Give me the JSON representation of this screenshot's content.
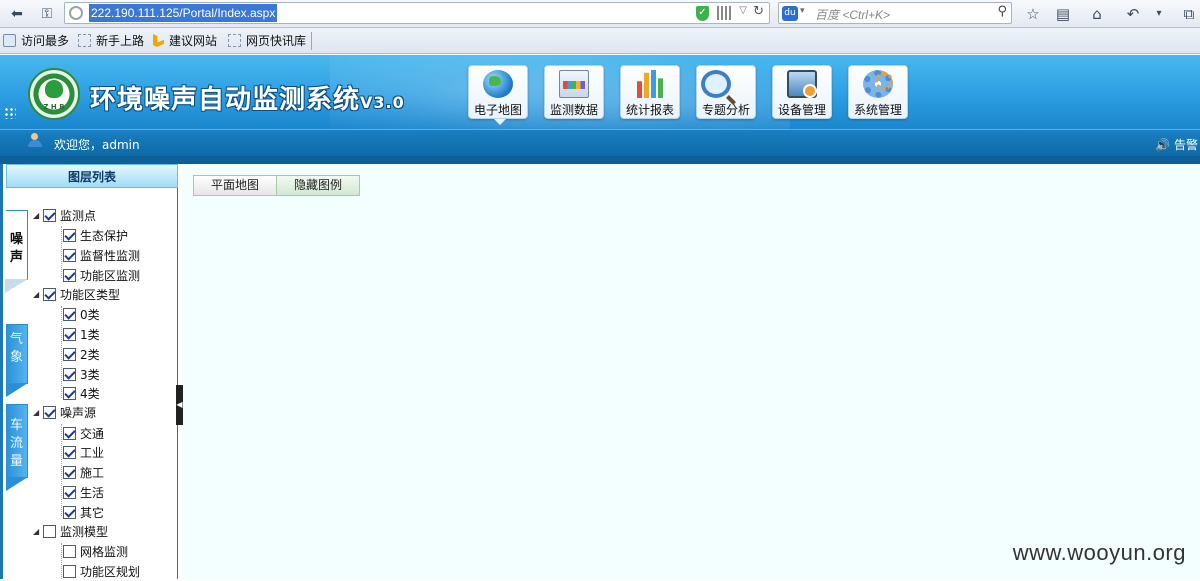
{
  "browser": {
    "url": "222.190.111.125/Portal/Index.aspx",
    "search_placeholder": "百度 <Ctrl+K>",
    "bookmarks": [
      {
        "label": "访问最多"
      },
      {
        "label": "新手上路"
      },
      {
        "label": "建议网站"
      },
      {
        "label": "网页快讯库"
      }
    ]
  },
  "app": {
    "title": "环境噪声自动监测系统",
    "version": "V3.0",
    "logo_text": "Z H B",
    "nav": [
      {
        "label": "电子地图",
        "icon": "globe-icon",
        "active": true
      },
      {
        "label": "监测数据",
        "icon": "monitor-data-icon"
      },
      {
        "label": "统计报表",
        "icon": "bar-chart-icon"
      },
      {
        "label": "专题分析",
        "icon": "magnifier-icon"
      },
      {
        "label": "设备管理",
        "icon": "device-icon"
      },
      {
        "label": "系统管理",
        "icon": "gear-icon"
      }
    ],
    "welcome": "欢迎您，admin",
    "alarm": "🔊 告警"
  },
  "layer_panel": {
    "title": "图层列表",
    "side_tabs": [
      "噪声",
      "气象",
      "车流量"
    ],
    "tree": {
      "monitoring_points": {
        "label": "监测点",
        "checked": true,
        "children": [
          "生态保护",
          "监督性监测",
          "功能区监测"
        ]
      },
      "zone_types": {
        "label": "功能区类型",
        "checked": true,
        "children": [
          "0类",
          "1类",
          "2类",
          "3类",
          "4类"
        ]
      },
      "noise_sources": {
        "label": "噪声源",
        "checked": true,
        "children": [
          "交通",
          "工业",
          "施工",
          "生活",
          "其它"
        ]
      },
      "models": {
        "label": "监测模型",
        "checked": false,
        "children": [
          "网格监测",
          "功能区规划"
        ]
      }
    }
  },
  "map": {
    "tabs": [
      "平面地图",
      "隐藏图例"
    ]
  },
  "watermark": "www.wooyun.org"
}
